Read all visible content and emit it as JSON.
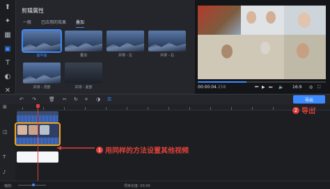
{
  "props": {
    "title": "剪辑属性",
    "tabs": [
      "一般",
      "已应用的效果",
      "叠加"
    ],
    "presets": [
      "画中画",
      "叠加",
      "并排 - 左",
      "并排 - 右",
      "并排 - 顶部",
      "并排 - 底部"
    ]
  },
  "preview": {
    "time_current": "00:00:04",
    "time_ms": ".258",
    "aspect": "16:9"
  },
  "export": {
    "label": "导出"
  },
  "annotations": [
    {
      "num": "1",
      "text": "用同样的方法设置其他视频"
    },
    {
      "num": "2",
      "text": "导出"
    }
  ],
  "status": {
    "zoom_label": "缩放:",
    "project_length_label": "项目长度:",
    "project_length": "00:00"
  },
  "colors": {
    "accent": "#3d8bff",
    "annotation": "#e0413a",
    "selection": "#f2a51b"
  }
}
